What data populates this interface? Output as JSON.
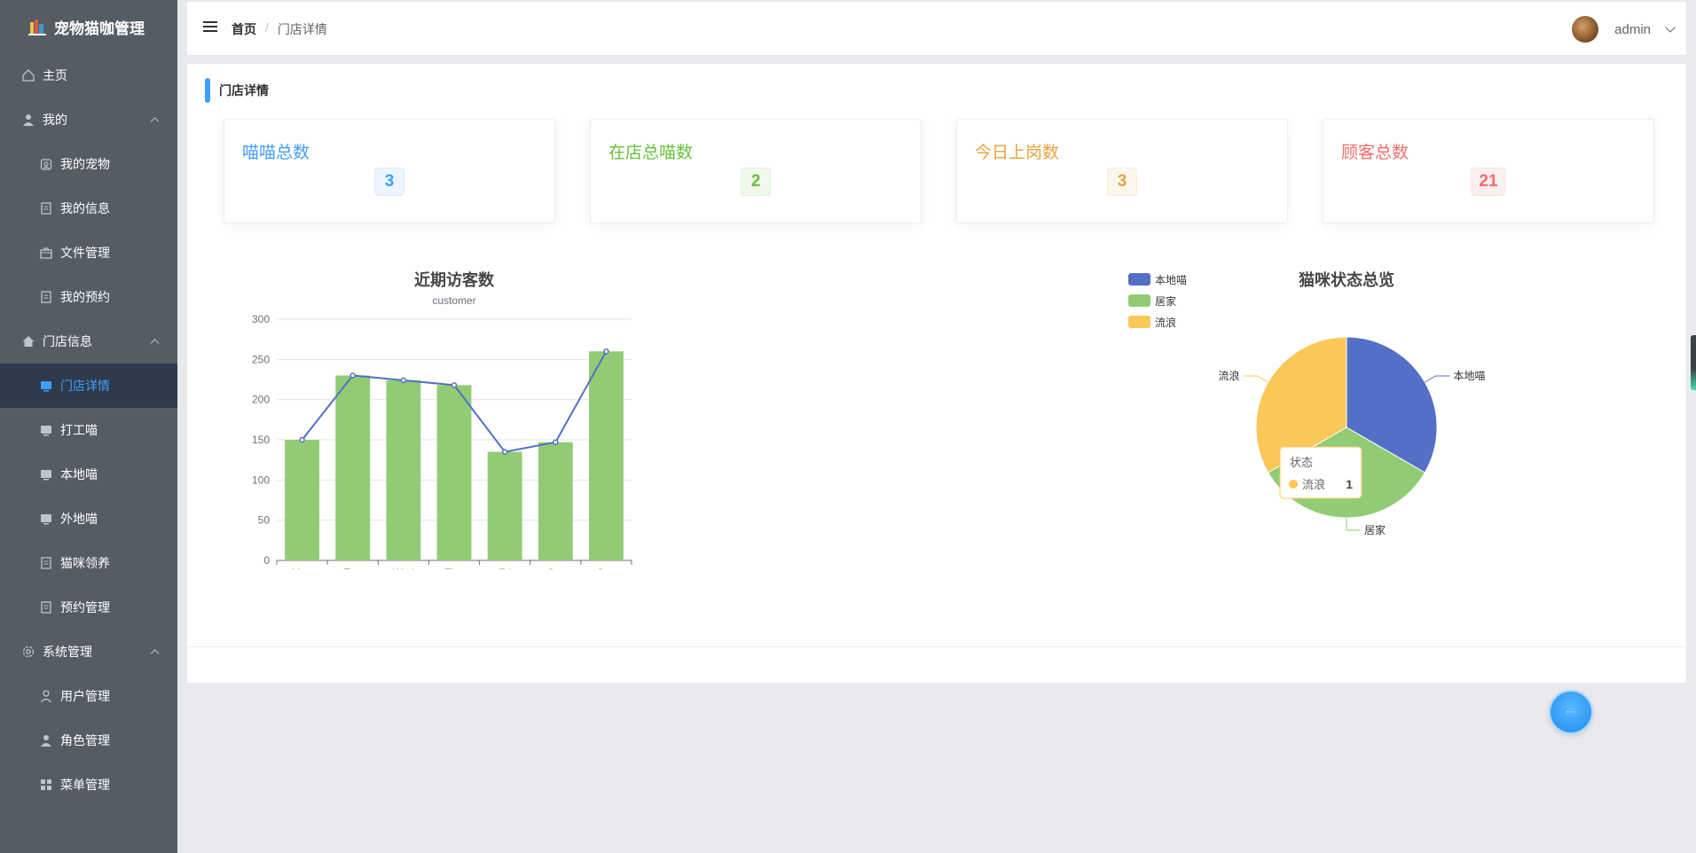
{
  "app": {
    "title": "宠物猫咖管理"
  },
  "sidebar": {
    "items": [
      {
        "label": "主页",
        "level": "top",
        "icon": "home-icon"
      },
      {
        "label": "我的",
        "level": "top",
        "icon": "user-icon",
        "expanded": true
      },
      {
        "label": "我的宠物",
        "level": "sub",
        "icon": "pet-icon"
      },
      {
        "label": "我的信息",
        "level": "sub",
        "icon": "document-icon"
      },
      {
        "label": "文件管理",
        "level": "sub",
        "icon": "briefcase-icon"
      },
      {
        "label": "我的预约",
        "level": "sub",
        "icon": "document-icon"
      },
      {
        "label": "门店信息",
        "level": "top",
        "icon": "house-icon",
        "expanded": true
      },
      {
        "label": "门店详情",
        "level": "sub",
        "icon": "monitor-icon",
        "active": true
      },
      {
        "label": "打工喵",
        "level": "sub",
        "icon": "monitor-icon"
      },
      {
        "label": "本地喵",
        "level": "sub",
        "icon": "monitor-icon"
      },
      {
        "label": "外地喵",
        "level": "sub",
        "icon": "monitor-icon"
      },
      {
        "label": "猫咪领养",
        "level": "sub",
        "icon": "document-icon"
      },
      {
        "label": "预约管理",
        "level": "sub",
        "icon": "document-icon"
      },
      {
        "label": "系统管理",
        "level": "top",
        "icon": "gear-icon",
        "expanded": true
      },
      {
        "label": "用户管理",
        "level": "sub",
        "icon": "user-outline-icon"
      },
      {
        "label": "角色管理",
        "level": "sub",
        "icon": "user-icon"
      },
      {
        "label": "菜单管理",
        "level": "sub",
        "icon": "grid-icon"
      }
    ]
  },
  "header": {
    "breadcrumb_home": "首页",
    "breadcrumb_sep": "/",
    "breadcrumb_current": "门店详情",
    "username": "admin"
  },
  "section": {
    "title": "门店详情"
  },
  "stats": [
    {
      "title": "喵喵总数",
      "value": "3",
      "color": "#409eff",
      "bg": "#ecf5ff",
      "border": "#d9ecff"
    },
    {
      "title": "在店总喵数",
      "value": "2",
      "color": "#67c23a",
      "bg": "#f0f9eb",
      "border": "#e1f3d8"
    },
    {
      "title": "今日上岗数",
      "value": "3",
      "color": "#e6a23c",
      "bg": "#fdf6ec",
      "border": "#faecd8"
    },
    {
      "title": "顾客总数",
      "value": "21",
      "color": "#f56c6c",
      "bg": "#fef0f0",
      "border": "#fde2e2"
    }
  ],
  "chart_data": [
    {
      "type": "bar",
      "title": "近期访客数",
      "subtitle": "customer",
      "categories": [
        "Mon",
        "Tue",
        "Wed",
        "Thu",
        "Fri",
        "Sat",
        "Sun"
      ],
      "series": [
        {
          "type": "bar",
          "values": [
            150,
            230,
            224,
            218,
            135,
            147,
            260
          ],
          "color": "#91cc75"
        },
        {
          "type": "line",
          "values": [
            150,
            230,
            224,
            218,
            135,
            147,
            260
          ],
          "color": "#5470c6"
        }
      ],
      "ylim": [
        0,
        300
      ],
      "yticks": [
        0,
        50,
        100,
        150,
        200,
        250,
        300
      ],
      "grid": true
    },
    {
      "type": "pie",
      "title": "猫咪状态总览",
      "slices": [
        {
          "label": "本地喵",
          "value": 1,
          "color": "#5470c6"
        },
        {
          "label": "居家",
          "value": 1,
          "color": "#91cc75"
        },
        {
          "label": "流浪",
          "value": 1,
          "color": "#fac858"
        }
      ],
      "legend": "top-left",
      "tooltip": {
        "title": "状态",
        "label": "流浪",
        "value": "1"
      }
    }
  ],
  "fab": {
    "label": "···"
  }
}
